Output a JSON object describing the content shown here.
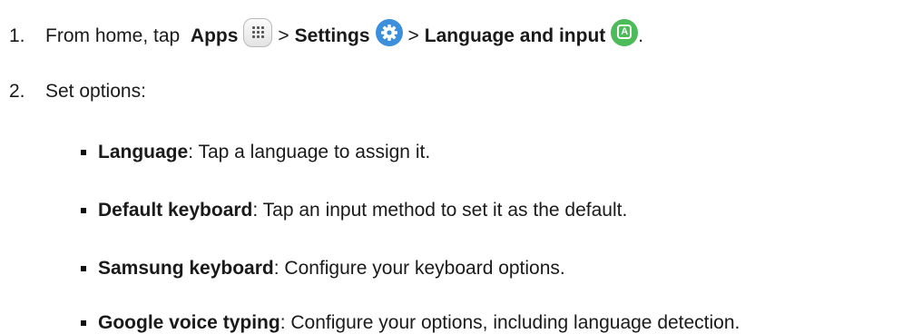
{
  "steps": [
    {
      "number": "1.",
      "intro": "From home, tap ",
      "apps_label": "Apps",
      "separator": ">",
      "settings_label": "Settings",
      "language_input_label": "Language and input",
      "end": "."
    },
    {
      "number": "2.",
      "text": "Set options:"
    }
  ],
  "icons": {
    "apps": "apps-grid-icon",
    "settings": "settings-gear-icon",
    "language": "language-input-icon"
  },
  "options": [
    {
      "term": "Language",
      "desc": ": Tap a language to assign it."
    },
    {
      "term": "Default keyboard",
      "desc": ": Tap an input method to set it as the default."
    },
    {
      "term": "Samsung keyboard",
      "desc": ": Configure your keyboard options."
    },
    {
      "term": "Google voice typing",
      "desc": ": Configure your options, including language detection."
    }
  ],
  "colors": {
    "settings_icon": "#3d8fdc",
    "language_icon": "#4cbb5a"
  }
}
